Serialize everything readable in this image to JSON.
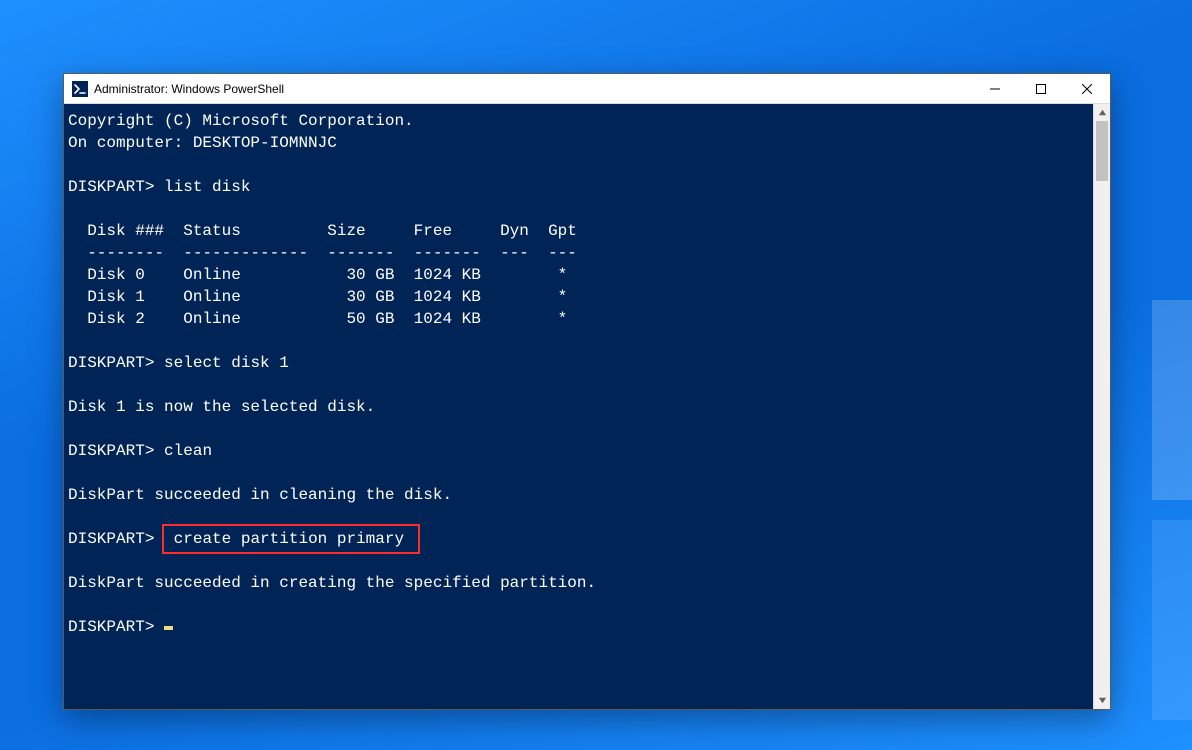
{
  "window": {
    "title": "Administrator: Windows PowerShell"
  },
  "terminal": {
    "copyright": "Copyright (C) Microsoft Corporation.",
    "computer": "On computer: DESKTOP-IOMNNJC",
    "prompt": "DISKPART>",
    "cmd_list": "list disk",
    "table": {
      "header": "  Disk ###  Status         Size     Free     Dyn  Gpt",
      "divider": "  --------  -------------  -------  -------  ---  ---",
      "rows": [
        "  Disk 0    Online           30 GB  1024 KB        *",
        "  Disk 1    Online           30 GB  1024 KB        *",
        "  Disk 2    Online           50 GB  1024 KB        *"
      ]
    },
    "cmd_select": "select disk 1",
    "msg_selected": "Disk 1 is now the selected disk.",
    "cmd_clean": "clean",
    "msg_cleaned": "DiskPart succeeded in cleaning the disk.",
    "cmd_create": "create partition primary",
    "msg_created": "DiskPart succeeded in creating the specified partition."
  }
}
